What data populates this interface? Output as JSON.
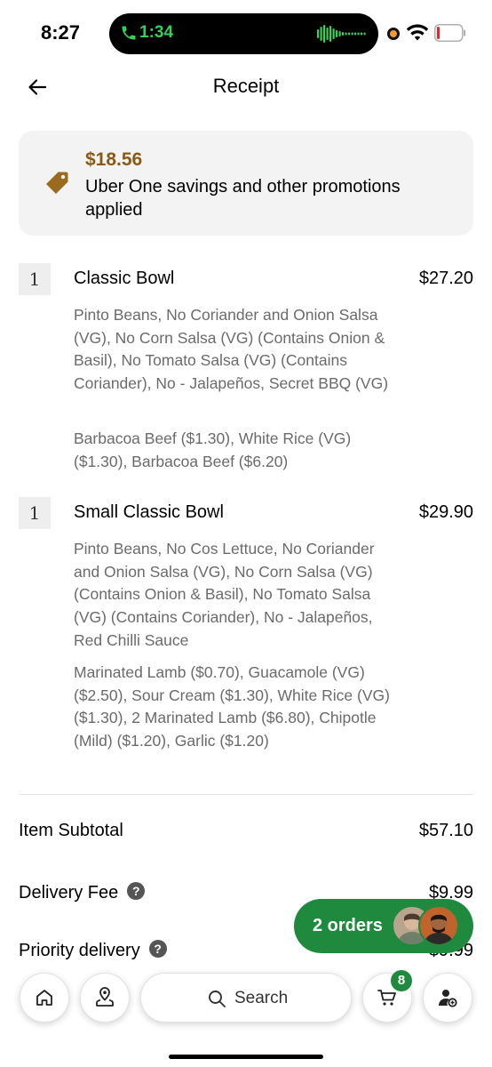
{
  "status_bar": {
    "time": "8:27",
    "call_duration": "1:34",
    "icons": [
      "phone-icon",
      "audio-wave-icon",
      "camera-indicator-icon",
      "wifi-icon",
      "battery-icon"
    ]
  },
  "header": {
    "title": "Receipt",
    "back_icon": "arrow-left-icon"
  },
  "promo": {
    "amount": "$18.56",
    "text": "Uber One savings and other promotions applied",
    "icon": "price-tag-icon",
    "amount_color": "#8b5a16"
  },
  "items": [
    {
      "qty": "1",
      "name": "Classic Bowl",
      "price": "$27.20",
      "desc1": "Pinto Beans, No Coriander and Onion Salsa (VG), No Corn Salsa (VG) (Contains Onion & Basil), No Tomato Salsa (VG) (Contains Coriander), No - Jalapeños, Secret BBQ (VG)",
      "desc2": "Barbacoa Beef ($1.30), White Rice (VG) ($1.30), Barbacoa Beef ($6.20)"
    },
    {
      "qty": "1",
      "name": "Small Classic Bowl",
      "price": "$29.90",
      "desc1": "Pinto Beans, No Cos Lettuce, No Coriander and Onion Salsa (VG), No Corn Salsa (VG) (Contains Onion & Basil), No Tomato Salsa (VG) (Contains Coriander), No - Jalapeños, Red Chilli Sauce",
      "desc2": "Marinated Lamb ($0.70), Guacamole (VG) ($2.50), Sour Cream ($1.30), White Rice (VG) ($1.30), 2  Marinated Lamb ($6.80), Chipotle (Mild) ($1.20), Garlic ($1.20)"
    }
  ],
  "summary": {
    "subtotal_label": "Item Subtotal",
    "subtotal_value": "$57.10",
    "delivery_label": "Delivery Fee",
    "delivery_value": "$9.99",
    "priority_label": "Priority delivery",
    "priority_value": "$9.99"
  },
  "orders_pill": {
    "label": "2 orders",
    "color": "#1f8a3e"
  },
  "bottom_nav": {
    "search_label": "Search",
    "cart_badge": "8",
    "icons": [
      "home-icon",
      "location-icon",
      "search-icon",
      "cart-icon",
      "account-icon"
    ]
  }
}
